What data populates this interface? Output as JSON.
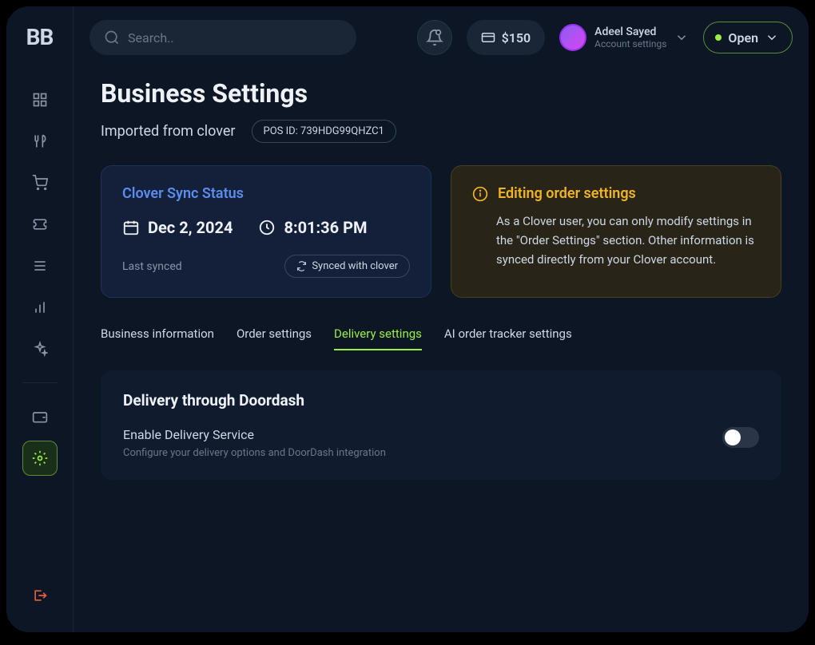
{
  "logo": "BB",
  "search": {
    "placeholder": "Search.."
  },
  "topbar": {
    "money_amount": "$150",
    "user_name": "Adeel Sayed",
    "user_sub": "Account settings",
    "open_label": "Open"
  },
  "page": {
    "title": "Business Settings",
    "subtitle": "Imported from clover",
    "pos_id": "POS ID: 739HDG99QHZC1"
  },
  "sync_card": {
    "title": "Clover Sync Status",
    "date": "Dec 2, 2024",
    "time": "8:01:36 PM",
    "last_synced_label": "Last synced",
    "button": "Synced with clover"
  },
  "warn_card": {
    "title": "Editing order settings",
    "text": "As a Clover user, you can only modify settings in the \"Order Settings\" section. Other information is synced directly from your Clover account."
  },
  "tabs": [
    {
      "label": "Business information"
    },
    {
      "label": "Order settings"
    },
    {
      "label": "Delivery settings"
    },
    {
      "label": "AI order tracker settings"
    }
  ],
  "panel": {
    "title": "Delivery through Doordash",
    "setting_label": "Enable Delivery Service",
    "setting_desc": "Configure your delivery options and DoorDash integration"
  }
}
